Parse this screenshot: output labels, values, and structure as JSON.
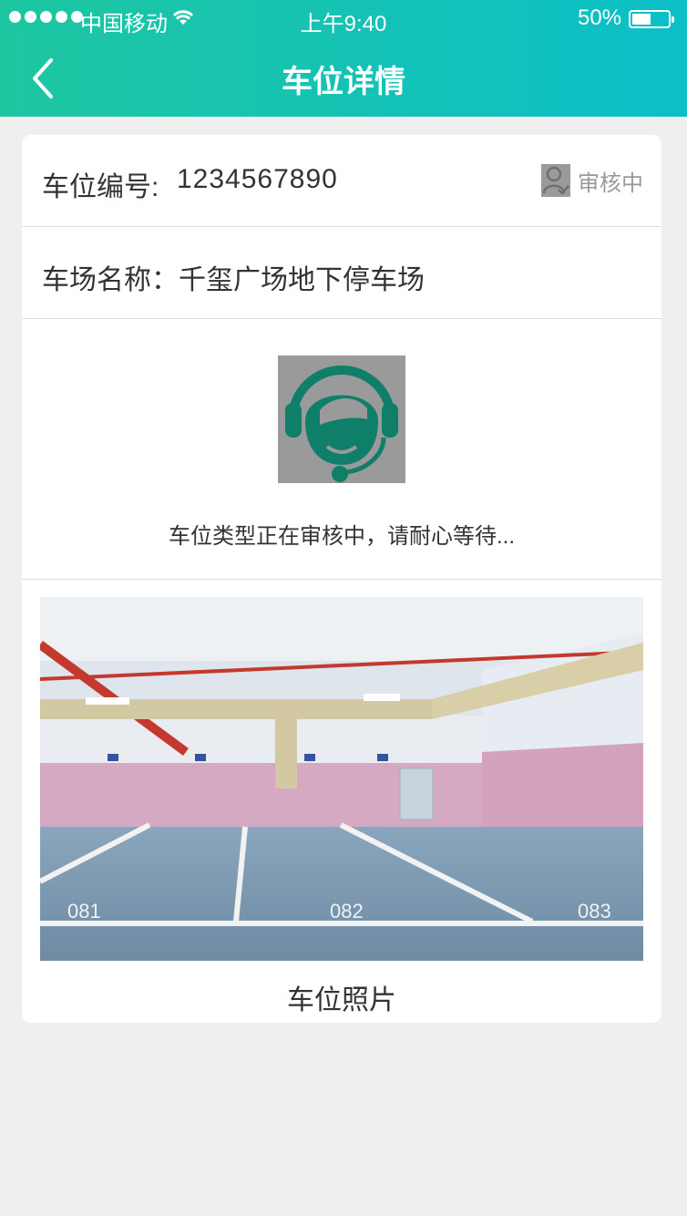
{
  "status_bar": {
    "carrier": "中国移动",
    "time": "上午9:40",
    "battery": "50%"
  },
  "nav": {
    "title": "车位详情"
  },
  "spot": {
    "number_label": "车位编号:",
    "number_value": "1234567890",
    "review_status": "审核中",
    "lot_label": "车场名称：",
    "lot_name": "千玺广场地下停车场"
  },
  "type_review": {
    "message": "车位类型正在审核中，请耐心等待..."
  },
  "photo": {
    "caption": "车位照片",
    "bay_numbers": [
      "081",
      "082",
      "083"
    ]
  },
  "colors": {
    "header_start": "#1ec6a0",
    "header_end": "#0bbfc8",
    "text": "#333333",
    "divider": "#dddddd",
    "avatar_green": "#0f7f6a"
  },
  "icons": {
    "back": "back-arrow-icon",
    "wifi": "wifi-icon",
    "battery": "battery-icon",
    "review": "user-check-icon",
    "service": "customer-service-avatar"
  }
}
